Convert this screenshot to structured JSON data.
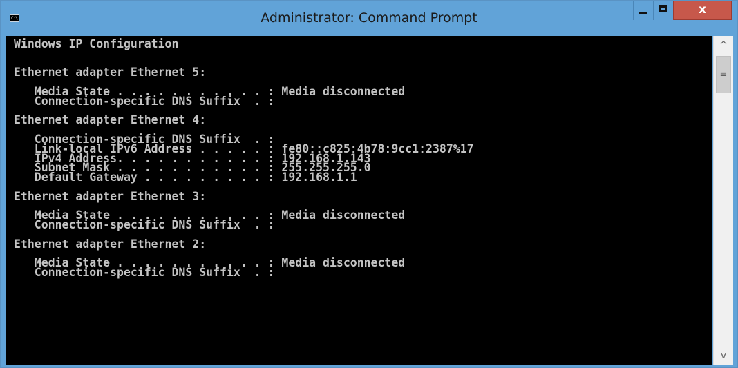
{
  "window": {
    "title": "Administrator: Command Prompt",
    "icon_name": "cmd-icon",
    "icon_text": "C:\\."
  },
  "controls": {
    "minimize": "minimize-icon",
    "maximize": "maximize-icon",
    "close": "close-icon",
    "close_glyph": "x"
  },
  "console": {
    "lines": [
      "Windows IP Configuration",
      "",
      "",
      "Ethernet adapter Ethernet 5:",
      "",
      "   Media State . . . . . . . . . . . : Media disconnected",
      "   Connection-specific DNS Suffix  . :",
      "",
      "Ethernet adapter Ethernet 4:",
      "",
      "   Connection-specific DNS Suffix  . :",
      "   Link-local IPv6 Address . . . . . : fe80::c825:4b78:9cc1:2387%17",
      "   IPv4 Address. . . . . . . . . . . : 192.168.1.143",
      "   Subnet Mask . . . . . . . . . . . : 255.255.255.0",
      "   Default Gateway . . . . . . . . . : 192.168.1.1",
      "",
      "Ethernet adapter Ethernet 3:",
      "",
      "   Media State . . . . . . . . . . . : Media disconnected",
      "   Connection-specific DNS Suffix  . :",
      "",
      "Ethernet adapter Ethernet 2:",
      "",
      "   Media State . . . . . . . . . . . : Media disconnected",
      "   Connection-specific DNS Suffix  . :"
    ]
  },
  "scrollbar": {
    "up_arrow": "^",
    "down_arrow": "v",
    "grip": "≡"
  },
  "colors": {
    "title_bar": "#61a3d8",
    "close_button": "#c7584b",
    "console_background": "#000000",
    "console_text": "#c4c4c4"
  }
}
